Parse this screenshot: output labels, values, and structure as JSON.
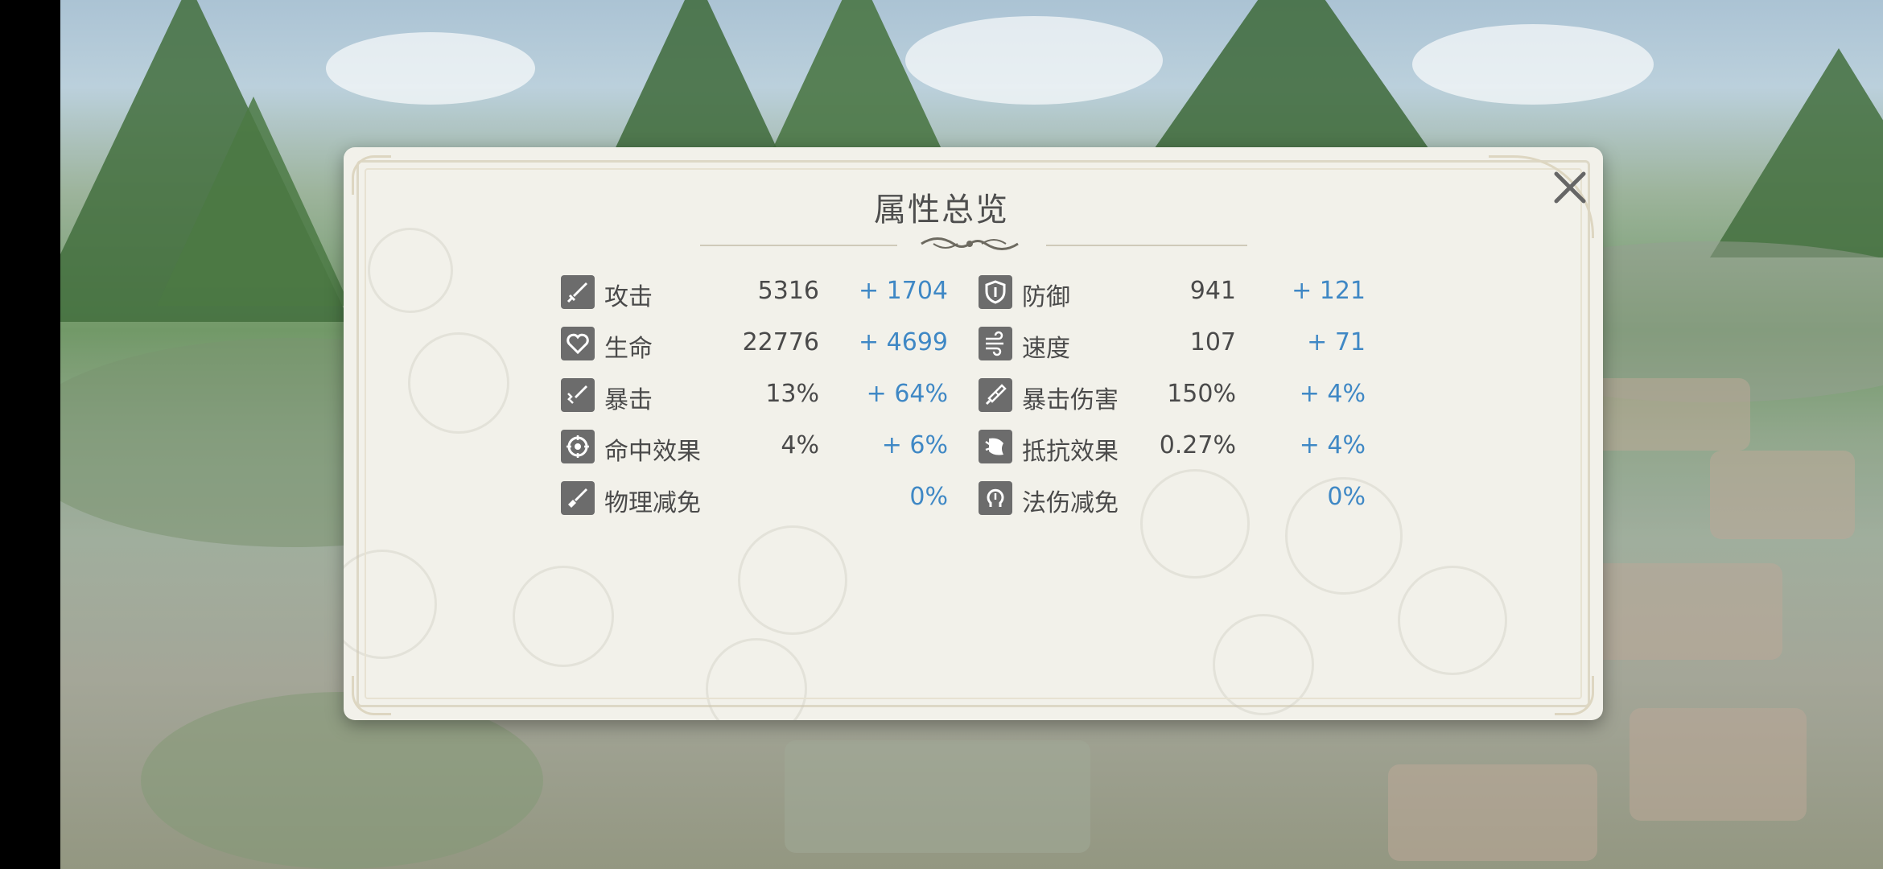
{
  "panel": {
    "title": "属性总览"
  },
  "stats_left": [
    {
      "icon": "sword-icon",
      "name": "攻击",
      "value": "5316",
      "bonus": "+ 1704"
    },
    {
      "icon": "heart-icon",
      "name": "生命",
      "value": "22776",
      "bonus": "+ 4699"
    },
    {
      "icon": "crit-sword-icon",
      "name": "暴击",
      "value": "13%",
      "bonus": "+ 64%"
    },
    {
      "icon": "target-icon",
      "name": "命中效果",
      "value": "4%",
      "bonus": "+ 6%"
    },
    {
      "icon": "physical-reduction-icon",
      "name": "物理减免",
      "value": "",
      "bonus": "0%"
    }
  ],
  "stats_right": [
    {
      "icon": "shield-icon",
      "name": "防御",
      "value": "941",
      "bonus": "+ 121"
    },
    {
      "icon": "wind-icon",
      "name": "速度",
      "value": "107",
      "bonus": "+ 71"
    },
    {
      "icon": "crit-damage-icon",
      "name": "暴击伤害",
      "value": "150%",
      "bonus": "+ 4%"
    },
    {
      "icon": "resist-icon",
      "name": "抵抗效果",
      "value": "0.27%",
      "bonus": "+ 4%"
    },
    {
      "icon": "magic-reduction-icon",
      "name": "法伤减免",
      "value": "",
      "bonus": "0%"
    }
  ],
  "colors": {
    "bonus": "#3f88c5",
    "text": "#4a4a4a",
    "panel_bg": "#f2f1ea",
    "icon_bg": "#6c6c6c"
  }
}
